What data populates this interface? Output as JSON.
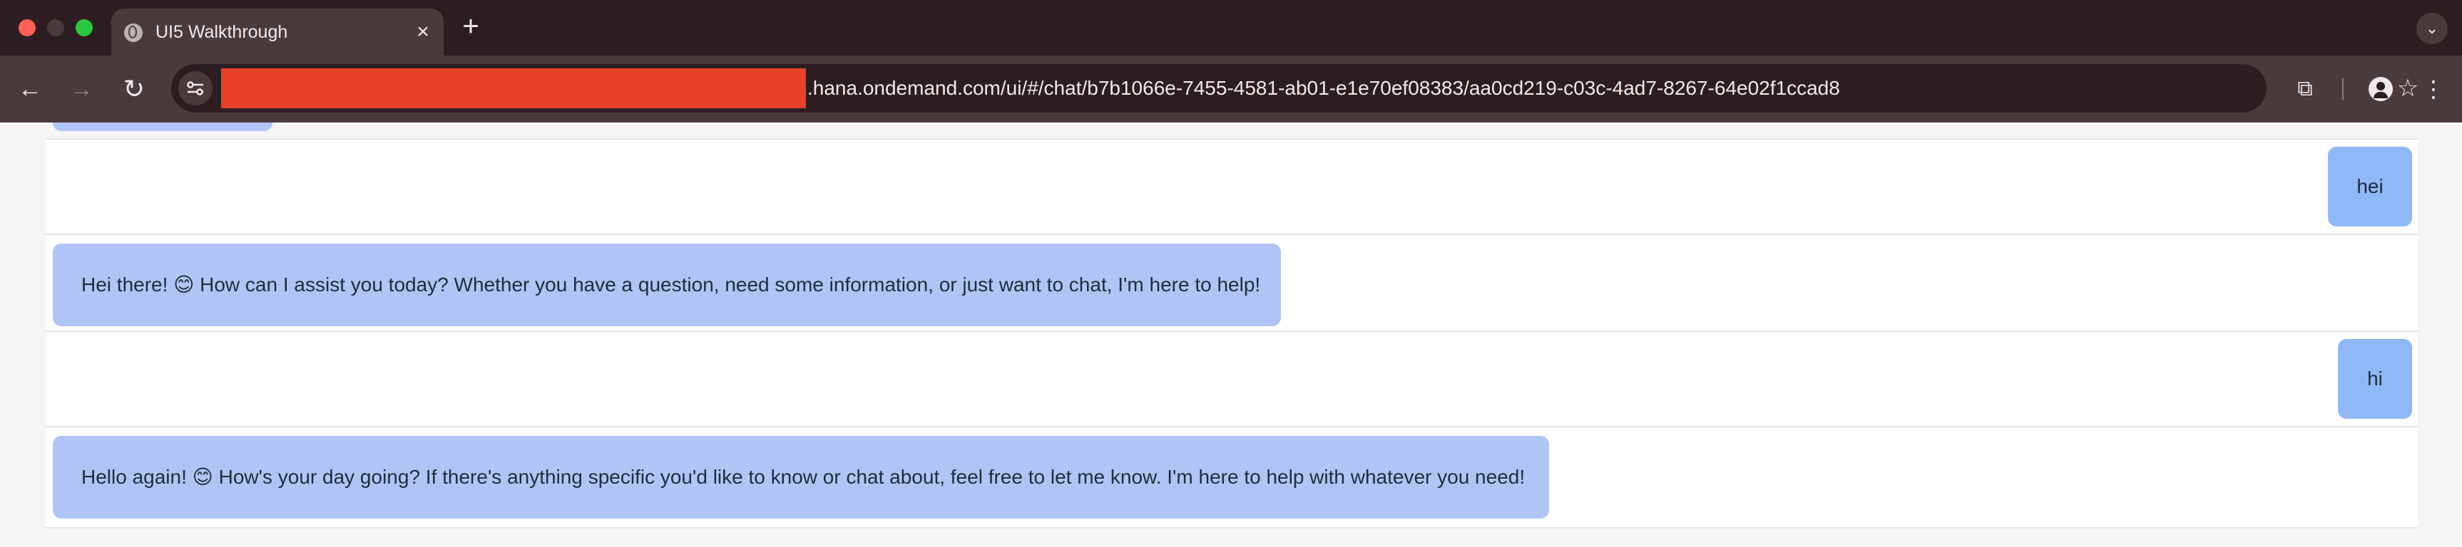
{
  "browser": {
    "tab": {
      "title": "UI5 Walkthrough",
      "favicon": "globe-icon",
      "close_label": "×"
    },
    "new_tab_label": "+",
    "tab_search_label": "⌄",
    "nav": {
      "back_label": "←",
      "forward_label": "→",
      "reload_label": "↻"
    },
    "address": {
      "visible_text": ".hana.ondemand.com/ui/#/chat/b7b1066e-7455-4581-ab01-e1e70ef08383/aa0cd219-c03c-4ad7-8267-64e02f1ccad8",
      "redacted": true
    },
    "bookmark_label": "☆",
    "extensions_label": "⧉",
    "menu_label": "⋮"
  },
  "chat": {
    "messages": [
      {
        "role": "user",
        "text": "hei"
      },
      {
        "role": "assistant",
        "text": "Hei there! 😊 How can I assist you today? Whether you have a question, need some information, or just want to chat, I'm here to help!"
      },
      {
        "role": "user",
        "text": "hi"
      },
      {
        "role": "assistant",
        "text": "Hello again! 😊 How's your day going? If there's anything specific you'd like to know or chat about, feel free to let me know. I'm here to help with whatever you need!"
      }
    ]
  },
  "colors": {
    "tabstrip": "#2e1d20",
    "toolbar": "#4b3a3c",
    "redaction": "#e8412a",
    "user_bubble": "#8fb8f6",
    "assistant_bubble": "#b0c5f5",
    "page_background": "#f4f5f6"
  }
}
